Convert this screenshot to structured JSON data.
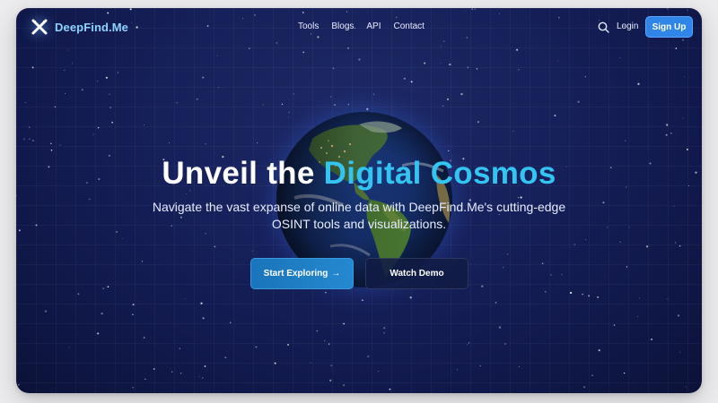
{
  "brand": {
    "name": "DeepFind.Me"
  },
  "nav": {
    "items": [
      {
        "label": "Tools"
      },
      {
        "label": "Blogs"
      },
      {
        "label": "API"
      },
      {
        "label": "Contact"
      }
    ],
    "search_icon": "search-icon",
    "login_label": "Login",
    "signup_label": "Sign Up"
  },
  "hero": {
    "title_prefix": "Unveil the ",
    "title_accent": "Digital Cosmos",
    "subtitle": "Navigate the vast expanse of online data with DeepFind.Me's cutting-edge OSINT tools and visualizations.",
    "primary_button": "Start Exploring",
    "primary_button_icon": "→",
    "secondary_button": "Watch Demo"
  },
  "colors": {
    "background": "#101849",
    "accent": "#34c4f2",
    "brand_text": "#8fd3ff",
    "signup_button": "#2f86e6",
    "primary_button": "#2589cf"
  }
}
